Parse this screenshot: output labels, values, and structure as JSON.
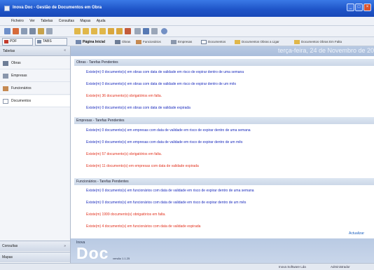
{
  "window": {
    "title": "Inova Doc - Gestão de Documentos em Obra"
  },
  "menu": [
    "Ficheiro",
    "Ver",
    "Tabelas",
    "Consultas",
    "Mapas",
    "Ajuda"
  ],
  "nav_tabs": [
    {
      "label": "PDF"
    },
    {
      "label": "TABS"
    }
  ],
  "nav_links": [
    {
      "label": "Página Inicial",
      "bold": true
    },
    {
      "label": "Obras"
    },
    {
      "label": "Funcionários"
    },
    {
      "label": "Empresas"
    },
    {
      "label": "Documentos"
    },
    {
      "label": "Documentos Obras a Ligar"
    },
    {
      "label": "Documentos Obras Em Falta"
    }
  ],
  "sidebar": {
    "header": "Tabelas",
    "items": [
      {
        "label": "Obras",
        "icon": "crane-icon"
      },
      {
        "label": "Empresas",
        "icon": "building-icon"
      },
      {
        "label": "Funcionários",
        "icon": "people-icon"
      },
      {
        "label": "Documentos",
        "icon": "document-icon",
        "active": true
      }
    ],
    "bottom": [
      {
        "label": "Consultas"
      },
      {
        "label": "Mapas"
      }
    ]
  },
  "main": {
    "date": "terça-feira, 24 de Novembro de 20",
    "sections": [
      {
        "title": "Obras - Tarefas Pendentes",
        "lines": [
          {
            "text": "Existe(m) 0 documento(s) em obras com data de validade em risco de expirar dentro de uma semana",
            "color": "blue"
          },
          {
            "text": "Existe(m) 0 documento(s) em obras com data de validade em risco de expirar dentro de um mês",
            "color": "blue"
          },
          {
            "text": "Existe(m) 36 documento(s) obrigatórios em falta.",
            "color": "red"
          },
          {
            "text": "Existe(m) 0 documento(s) em obras com data de validade expirada",
            "color": "blue"
          }
        ]
      },
      {
        "title": "Empresas - Tarefas Pendentes",
        "lines": [
          {
            "text": "Existe(m) 0 documento(s) em empresas com data de validade em risco de expirar dentro de uma semana",
            "color": "blue"
          },
          {
            "text": "Existe(m) 0 documento(s) em empresas com data de validade em risco de expirar dentro de um mês",
            "color": "blue"
          },
          {
            "text": "Existe(m) 57 documento(s) obrigatórios em falta.",
            "color": "red"
          },
          {
            "text": "Existe(m) 11 documento(s) em empresas com data de validade expirada",
            "color": "red"
          }
        ]
      },
      {
        "title": "Funcionários - Tarefas Pendentes",
        "lines": [
          {
            "text": "Existe(m) 0 documento(s) em funcionários com data de validade em risco de expirar dentro de uma semana",
            "color": "blue"
          },
          {
            "text": "Existe(m) 0 documento(s) em funcionários com data de validade em risco de expirar dentro de um mês",
            "color": "blue"
          },
          {
            "text": "Existe(m) 1999 documento(s) obrigatórios em falta.",
            "color": "red"
          },
          {
            "text": "Existe(m) 4 documento(s) em funcionários com data de validade expirada",
            "color": "red"
          }
        ]
      }
    ],
    "refresh_label": "Actualizar"
  },
  "footer": {
    "brand_small": "Inova",
    "brand": "Doc",
    "version": "versão 1.1.25"
  },
  "status": {
    "company": "Inova Software Lda",
    "user": "Administrador"
  },
  "colors": {
    "title_blue": "#1f55c8",
    "link_blue": "#1a2bbd",
    "alert_red": "#e2321e"
  }
}
